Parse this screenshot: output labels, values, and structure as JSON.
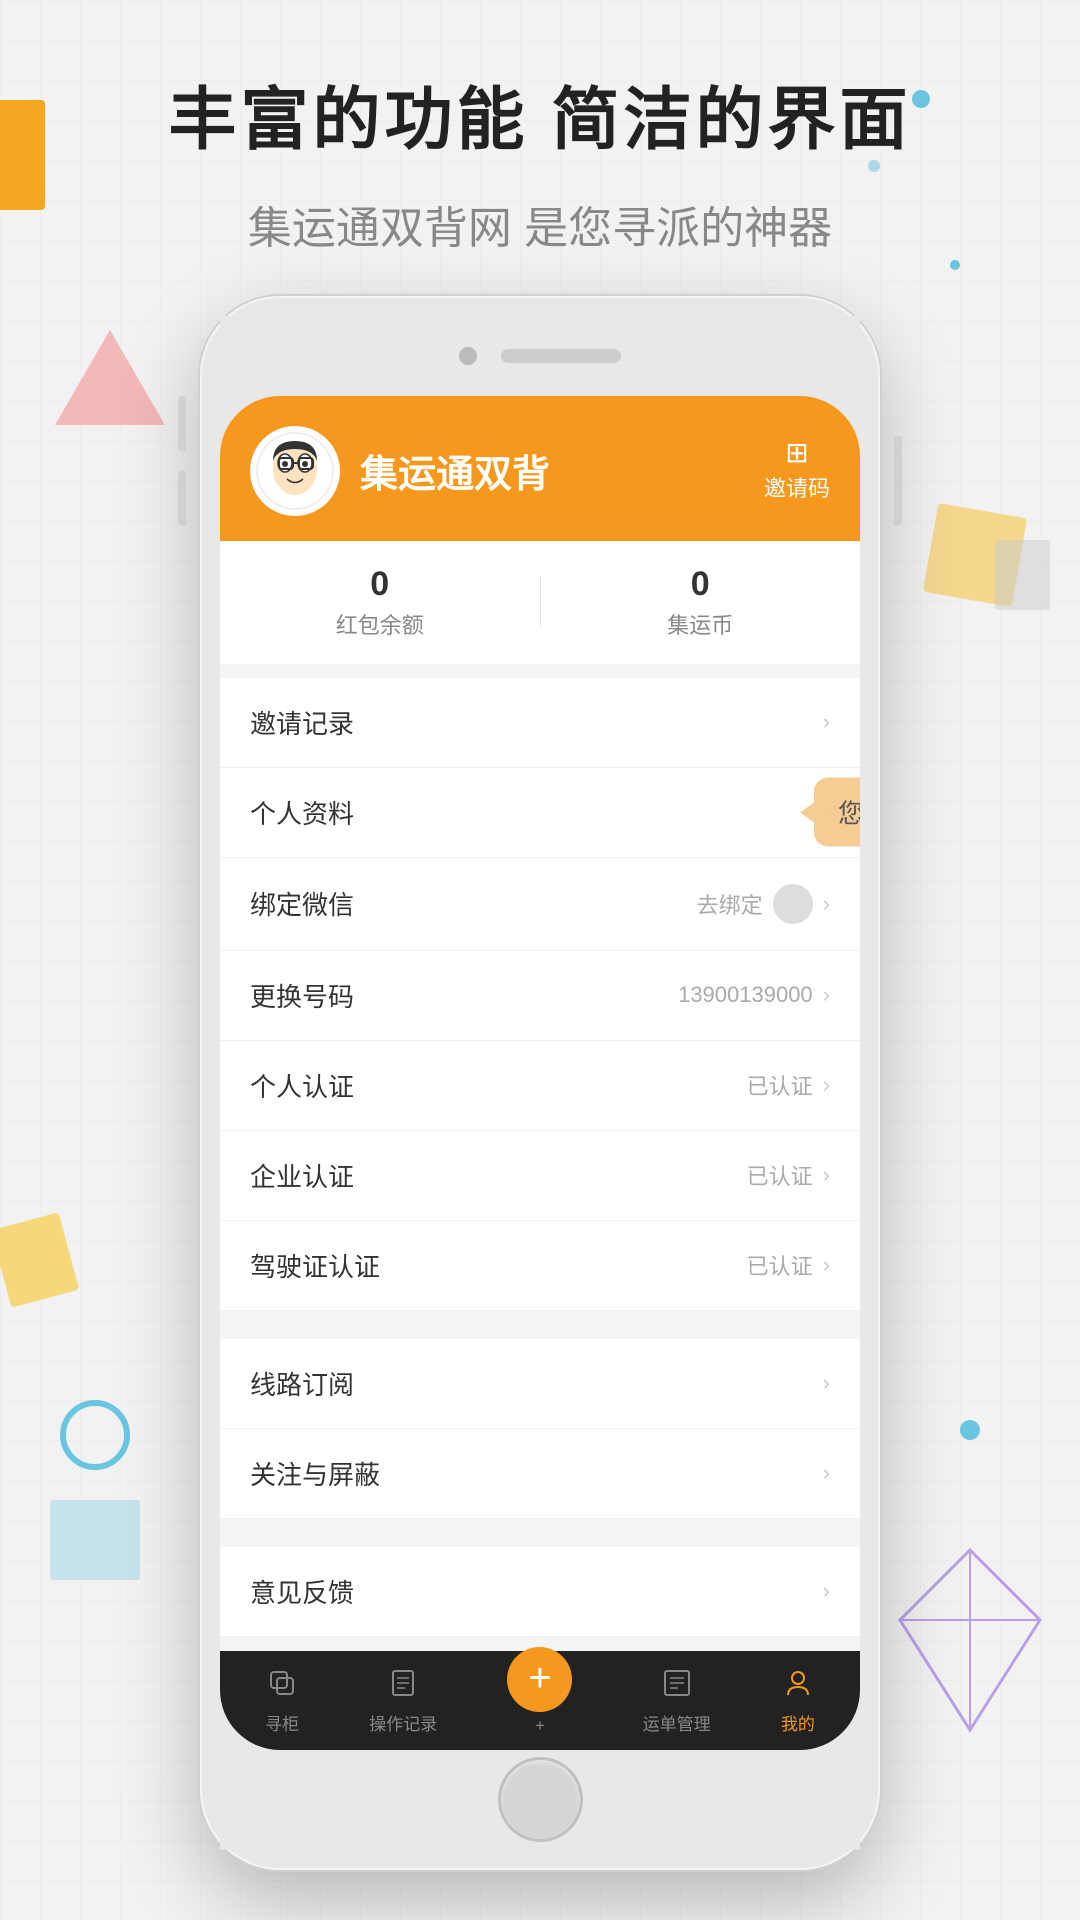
{
  "page": {
    "bg_color": "#f2f2f2"
  },
  "header": {
    "main_title": "丰富的功能 简洁的界面",
    "sub_title": "集运通双背网 是您寻派的神器"
  },
  "app": {
    "header": {
      "app_name": "集运通双背",
      "invite_label": "邀请码"
    },
    "stats": [
      {
        "value": "0",
        "label": "红包余额"
      },
      {
        "value": "0",
        "label": "集运币"
      }
    ],
    "menu": [
      {
        "label": "邀请记录",
        "value": "",
        "type": "arrow"
      },
      {
        "label": "个人资料",
        "value": "",
        "type": "arrow"
      },
      {
        "label": "绑定微信",
        "value": "去绑定",
        "type": "avatar_arrow"
      },
      {
        "label": "更换号码",
        "value": "13900139000",
        "type": "arrow"
      },
      {
        "label": "个人认证",
        "value": "已认证",
        "type": "arrow"
      },
      {
        "label": "企业认证",
        "value": "已认证",
        "type": "arrow"
      },
      {
        "label": "驾驶证认证",
        "value": "已认证",
        "type": "arrow"
      },
      {
        "label": "线路订阅",
        "value": "",
        "type": "arrow",
        "section_break": true
      },
      {
        "label": "关注与屏蔽",
        "value": "",
        "type": "arrow"
      },
      {
        "label": "意见反馈",
        "value": "",
        "type": "arrow",
        "section_break": true
      }
    ],
    "tooltip": "您所要的都在这里",
    "nav": [
      {
        "label": "寻柜",
        "icon": "📦",
        "active": false
      },
      {
        "label": "操作记录",
        "icon": "📋",
        "active": false
      },
      {
        "label": "+",
        "icon": "+",
        "active": false,
        "is_add": true
      },
      {
        "label": "运单管理",
        "icon": "📄",
        "active": false
      },
      {
        "label": "我的",
        "icon": "👤",
        "active": true
      }
    ]
  }
}
